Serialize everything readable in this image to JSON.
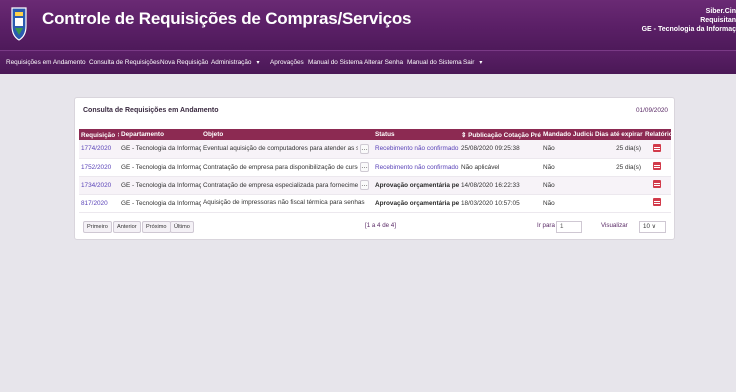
{
  "header": {
    "title": "Controle de Requisições de Compras/Serviços",
    "user": {
      "name": "Siber.Cin",
      "role": "Requisitan",
      "department": "GE - Tecnologia da Informaç"
    }
  },
  "nav": [
    {
      "label": "Requisições em Andamento",
      "caret": false
    },
    {
      "label": "Consulta de Requisições",
      "caret": false
    },
    {
      "label": "Nova Requisição",
      "caret": false
    },
    {
      "label": "Administração",
      "caret": true
    },
    {
      "label": "Aprovações",
      "caret": false
    },
    {
      "label": "Manual do Sistema",
      "caret": false
    },
    {
      "label": "Alterar Senha",
      "caret": false
    },
    {
      "label": "Manual do Sistema",
      "caret": false
    },
    {
      "label": "Sair",
      "caret": true
    }
  ],
  "panel": {
    "title": "Consulta de Requisições em Andamento",
    "date": "01/09/2020"
  },
  "table": {
    "headers": [
      "Requisição ⇕",
      "Departamento",
      "Objeto",
      "Status",
      "⇕ Publicação Cotação Prévia",
      "Mandado Judicial",
      "Dias até expirar",
      "Relatório"
    ],
    "rows": [
      {
        "req": "1774/2020",
        "dept": "GE - Tecnologia da Informação",
        "obj": "Eventual aquisição de computadores para atender as secretari",
        "status": "Recebimento não confirmado",
        "status_style": "link",
        "pub": "25/08/2020 09:25:38",
        "mandado": "Não",
        "dias": "25 dia(s)"
      },
      {
        "req": "1752/2020",
        "dept": "GE - Tecnologia da Informação",
        "obj": "Contratação de empresa para disponibilização de cursos onlin",
        "status": "Recebimento não confirmado",
        "status_style": "link",
        "pub": "Não aplicável",
        "mandado": "Não",
        "dias": "25 dia(s)"
      },
      {
        "req": "1734/2020",
        "dept": "GE - Tecnologia da Informação",
        "obj": "Contratação de empresa especializada para fornecimento de li",
        "status": "Aprovação orçamentária pendente",
        "status_style": "bold",
        "pub": "14/08/2020 16:22:33",
        "mandado": "Não",
        "dias": ""
      },
      {
        "req": "817/2020",
        "dept": "GE - Tecnologia da Informação",
        "obj": "Aquisição de impressoras não fiscal térmica para senhas",
        "status": "Aprovação orçamentária pendente",
        "status_style": "bold",
        "pub": "18/03/2020 10:57:05",
        "mandado": "Não",
        "dias": ""
      }
    ]
  },
  "pager": {
    "first": "Primeiro",
    "prev": "Anterior",
    "next": "Próximo",
    "last": "Último",
    "info": "[1 a 4 de 4]",
    "goto_label": "Ir para",
    "goto_value": "1",
    "view_label": "Visualizar",
    "view_value": "10 ∨"
  }
}
